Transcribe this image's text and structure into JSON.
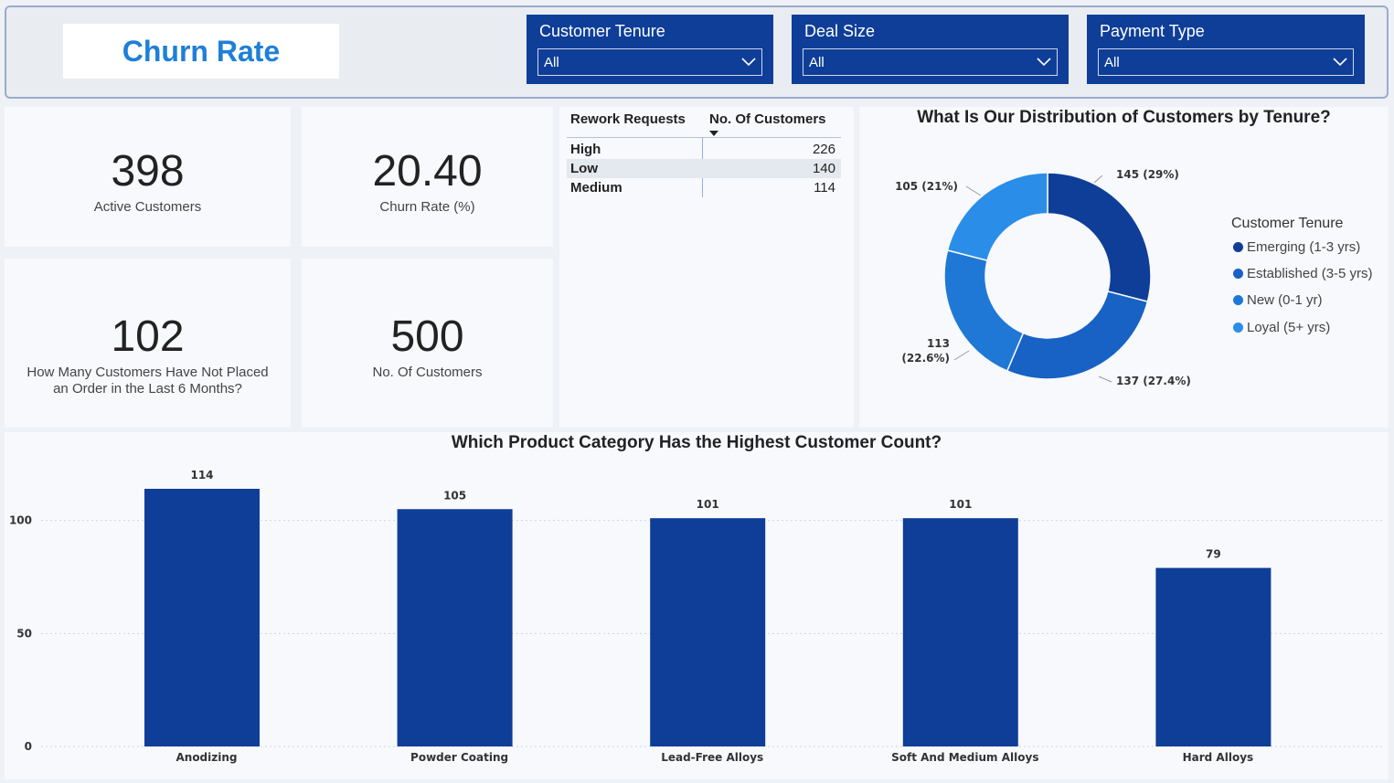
{
  "header": {
    "title": "Churn Rate",
    "slicers": [
      {
        "label": "Customer Tenure",
        "value": "All"
      },
      {
        "label": "Deal Size",
        "value": "All"
      },
      {
        "label": "Payment Type",
        "value": "All"
      }
    ]
  },
  "kpis": [
    {
      "value": "398",
      "label": "Active Customers"
    },
    {
      "value": "20.40",
      "label": "Churn Rate (%)"
    },
    {
      "value": "102",
      "label": "How Many Customers Have Not Placed an Order in the Last 6 Months?"
    },
    {
      "value": "500",
      "label": "No. Of Customers"
    }
  ],
  "rework_table": {
    "col1": "Rework Requests",
    "col2": "No. Of Customers",
    "rows": [
      {
        "category": "High",
        "value": "226"
      },
      {
        "category": "Low",
        "value": "140"
      },
      {
        "category": "Medium",
        "value": "114"
      }
    ]
  },
  "colors": {
    "dark_blue": "#0f3e98",
    "mid_blue": "#1762c4",
    "blue": "#1f78d6",
    "light_blue": "#2a8ee8",
    "title_blue": "#1e7fd7"
  },
  "chart_data": [
    {
      "type": "pie",
      "title": "What Is Our Distribution of Customers by Tenure?",
      "legend_title": "Customer Tenure",
      "legend_position": "right",
      "legend": [
        "Emerging (1-3 yrs)",
        "Established (3-5 yrs)",
        "New (0-1 yr)",
        "Loyal (5+ yrs)"
      ],
      "slices": [
        {
          "value": 145,
          "label": "145 (29%)",
          "color": "#0f3e98"
        },
        {
          "value": 137,
          "label": "137 (27.4%)",
          "color": "#1762c4"
        },
        {
          "value": 113,
          "label_line1": "113",
          "label_line2": "(22.6%)",
          "color": "#1f78d6"
        },
        {
          "value": 105,
          "label": "105 (21%)",
          "color": "#2a8ee8"
        }
      ]
    },
    {
      "type": "bar",
      "title": "Which Product Category Has the Highest Customer Count?",
      "categories": [
        "Anodizing",
        "Powder Coating",
        "Lead-Free Alloys",
        "Soft And Medium Alloys",
        "Hard Alloys"
      ],
      "values": [
        114,
        105,
        101,
        101,
        79
      ],
      "yticks": [
        "100",
        "50",
        "0"
      ],
      "ylim": [
        0,
        114
      ],
      "grid": true,
      "color": "#0f3e98"
    }
  ]
}
